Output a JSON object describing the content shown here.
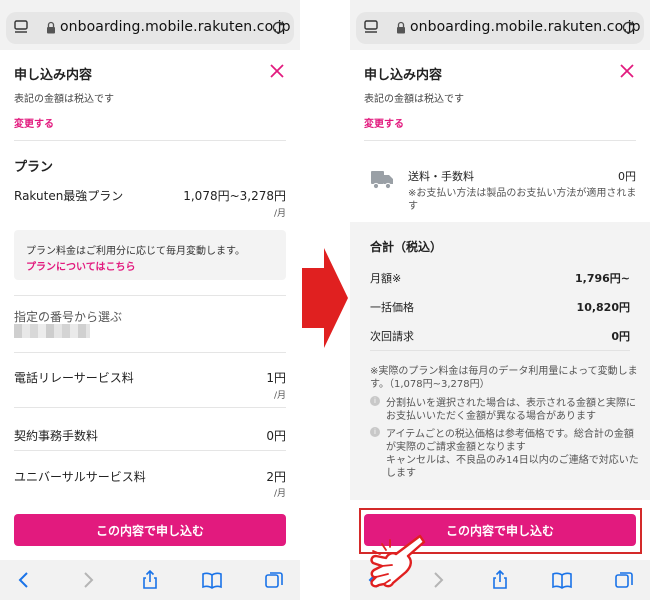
{
  "browser": {
    "url": "onboarding.mobile.rakuten.co.jp"
  },
  "left": {
    "title": "申し込み内容",
    "tax_note": "表記の金額は税込です",
    "change_link": "変更する",
    "plan_heading": "プラン",
    "plan_name": "Rakuten最強プラン",
    "plan_price": "1,078円~3,278円",
    "per_month": "/月",
    "plan_note": "プラン料金はご利用分に応じて毎月変動します。",
    "plan_link": "プランについてはこちら",
    "number_label": "指定の番号から選ぶ",
    "items": [
      {
        "label": "電話リレーサービス料",
        "price": "1円",
        "unit": "/月"
      },
      {
        "label": "契約事務手数料",
        "price": "0円",
        "unit": ""
      },
      {
        "label": "ユニバーサルサービス料",
        "price": "2円",
        "unit": "/月"
      }
    ],
    "cta": "この内容で申し込む"
  },
  "right": {
    "title": "申し込み内容",
    "tax_note": "表記の金額は税込です",
    "change_link": "変更する",
    "shipping_label": "送料・手数料",
    "shipping_price": "0円",
    "shipping_note_1": "※お支払い方法は製品のお支払い方法が適用されま",
    "shipping_note_2": "す",
    "total_heading": "合計（税込）",
    "monthly_label": "月額※",
    "monthly_value": "1,796円~",
    "lump_label": "一括価格",
    "lump_value": "10,820円",
    "next_label": "次回請求",
    "next_value": "0円",
    "footnote_1": "※実際のプラン料金は毎月のデータ利用量によって変動しま",
    "footnote_2": "す。（1,078円~3,278円）",
    "bullet1_l1": "分割払いを選択された場合は、表示される金額と実際に",
    "bullet1_l2": "お支払いいただく金額が異なる場合があります",
    "bullet2_l1": "アイテムごとの税込価格は参考価格です。総合計の金額",
    "bullet2_l2": "が実際のご請求金額となります",
    "bullet2_l3": "キャンセルは、不良品のみ14日以内のご連絡で対応いた",
    "bullet2_l4": "します",
    "bullet_glyph": "i",
    "cta": "この内容で申し込む"
  },
  "colors": {
    "accent": "#e21a7e",
    "highlight": "#d42a2a",
    "arrow": "#e02020",
    "ios_blue": "#1a73e8"
  },
  "icons": [
    "tabs-icon",
    "lock-icon",
    "reload-icon",
    "close-icon",
    "truck-icon",
    "info-icon",
    "back-icon",
    "forward-icon",
    "share-icon",
    "bookmarks-icon",
    "tab-overview-icon",
    "pointing-hand-icon",
    "red-arrow-icon"
  ]
}
